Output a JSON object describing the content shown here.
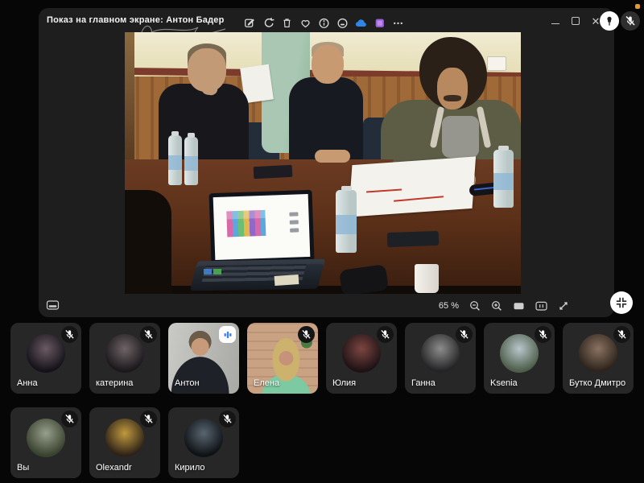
{
  "window": {
    "title": "Показ на главном экране: Антон Бадер",
    "has_notification_dot": true,
    "notification_color": "#e09a30"
  },
  "toolbar": {
    "icons": [
      "edit",
      "rotate",
      "delete",
      "favorite",
      "info",
      "slideshow",
      "upload-cloud",
      "albums",
      "more"
    ],
    "cloud_color": "#2f86e8",
    "albums_color": "#9b5fd6"
  },
  "floating_controls": {
    "pin_active": true,
    "microphone_muted": true
  },
  "viewer": {
    "zoom_level": "65 %",
    "controls": [
      "thumbnails-toggle",
      "zoom-out",
      "zoom-in",
      "fit-screen",
      "actual-size",
      "fullscreen",
      "shrink"
    ]
  },
  "participants": [
    {
      "name": "Анна",
      "muted": true,
      "speaking": false,
      "video": false,
      "avatar_colors": [
        "#6b5a62",
        "#15121a"
      ]
    },
    {
      "name": "катерина",
      "muted": true,
      "speaking": false,
      "video": false,
      "avatar_colors": [
        "#6e6466",
        "#1c181c"
      ]
    },
    {
      "name": "Антон",
      "muted": false,
      "speaking": true,
      "video": true,
      "scene": "anton"
    },
    {
      "name": "Елена",
      "muted": true,
      "speaking": false,
      "video": true,
      "scene": "elena"
    },
    {
      "name": "Юлия",
      "muted": true,
      "speaking": false,
      "video": false,
      "avatar_colors": [
        "#7c4640",
        "#1e1216"
      ]
    },
    {
      "name": "Ганна",
      "muted": true,
      "speaking": false,
      "video": false,
      "avatar_colors": [
        "#8d8d8d",
        "#242426"
      ]
    },
    {
      "name": "Ksenia",
      "muted": true,
      "speaking": false,
      "video": false,
      "avatar_colors": [
        "#b9c6cc",
        "#4e5e4a"
      ]
    },
    {
      "name": "Бутко Дмитро",
      "muted": true,
      "speaking": false,
      "video": false,
      "avatar_colors": [
        "#8a7260",
        "#2e241c"
      ]
    },
    {
      "name": "Вы",
      "muted": true,
      "speaking": false,
      "video": false,
      "avatar_colors": [
        "#97a08c",
        "#39412f"
      ]
    },
    {
      "name": "Olexandr",
      "muted": true,
      "speaking": false,
      "video": false,
      "avatar_colors": [
        "#c0993e",
        "#2e2218"
      ]
    },
    {
      "name": "Кирило",
      "muted": true,
      "speaking": false,
      "video": false,
      "avatar_colors": [
        "#5a6570",
        "#0e1216"
      ]
    }
  ],
  "colors": {
    "accent_blue": "#3b7ff0",
    "panel": "#1e1e1e",
    "tile": "#272727",
    "background": "#060606"
  }
}
